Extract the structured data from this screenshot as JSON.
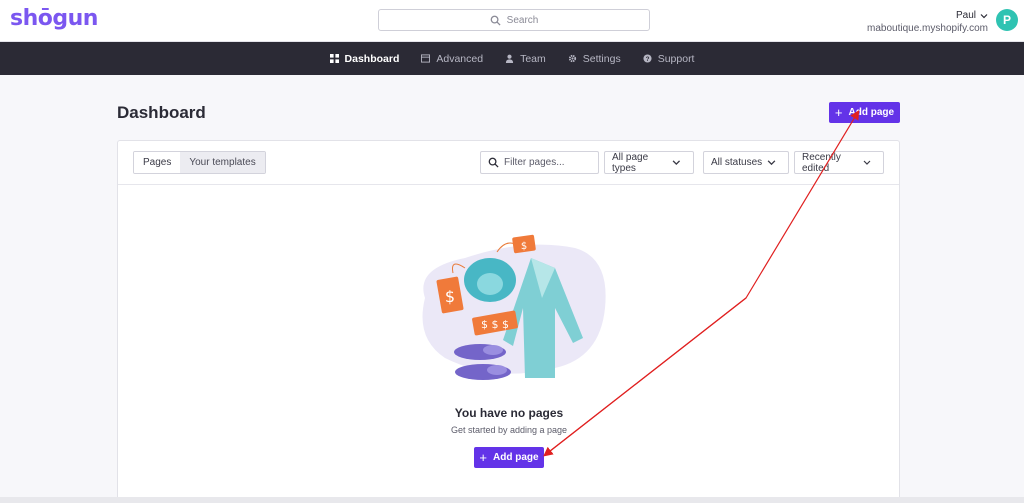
{
  "header": {
    "logo_text": "shōgun",
    "search_placeholder": "Search",
    "user_name": "Paul",
    "store_domain": "maboutique.myshopify.com",
    "avatar_letter": "P"
  },
  "nav": {
    "items": [
      {
        "label": "Dashboard",
        "icon": "grid-icon",
        "active": true
      },
      {
        "label": "Advanced",
        "icon": "window-icon",
        "active": false
      },
      {
        "label": "Team",
        "icon": "person-icon",
        "active": false
      },
      {
        "label": "Settings",
        "icon": "gear-icon",
        "active": false
      },
      {
        "label": "Support",
        "icon": "help-circle-icon",
        "active": false
      }
    ]
  },
  "main": {
    "title": "Dashboard",
    "add_page_label": "Add page",
    "tabs": [
      {
        "label": "Pages",
        "selected": true
      },
      {
        "label": "Your templates",
        "selected": false
      }
    ],
    "filter_placeholder": "Filter pages...",
    "page_type_select": "All page types",
    "status_select": "All statuses",
    "sort_select": "Recently edited",
    "empty_state": {
      "title": "You have no pages",
      "subtitle": "Get started by adding a page",
      "button_label": "Add page"
    }
  },
  "colors": {
    "brand": "#7b57f0",
    "primary_button": "#6333e8",
    "nav_background": "#2b2a35",
    "avatar": "#2fc3b2",
    "annotation_arrow": "#e02020"
  }
}
